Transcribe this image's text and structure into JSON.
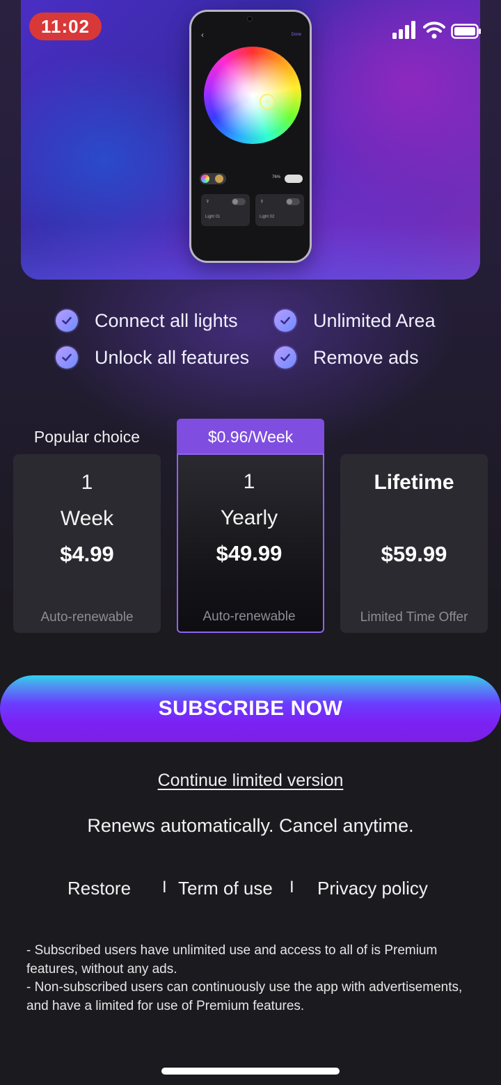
{
  "status_bar": {
    "time": "11:02"
  },
  "hero": {
    "phone": {
      "done_label": "Done",
      "brightness": "76%",
      "lights": [
        "Light 01",
        "Light 02"
      ]
    }
  },
  "features": [
    {
      "label": "Connect all lights"
    },
    {
      "label": "Unlimited Area"
    },
    {
      "label": "Unlock all features"
    },
    {
      "label": "Remove ads"
    }
  ],
  "plans": {
    "popular_label": "Popular choice",
    "selected_badge": "$0.96/Week",
    "items": [
      {
        "qty": "1",
        "period": "Week",
        "price": "$4.99",
        "footnote": "Auto-renewable"
      },
      {
        "qty": "1",
        "period": "Yearly",
        "price": "$49.99",
        "footnote": "Auto-renewable",
        "selected": true
      },
      {
        "title": "Lifetime",
        "price": "$59.99",
        "footnote": "Limited Time Offer"
      }
    ]
  },
  "cta": {
    "subscribe_label": "SUBSCRIBE NOW"
  },
  "continue_label": "Continue limited version",
  "renews_text": "Renews automatically. Cancel anytime.",
  "footer_links": {
    "restore": "Restore",
    "separator": "I",
    "terms": "Term of use",
    "privacy": "Privacy policy"
  },
  "notes": [
    "- Subscribed users have unlimited use and access to all of is Premium features, without any ads.",
    "- Non-subscribed users can continuously use the app with advertisements, and have a limited for use of Premium features."
  ],
  "colors": {
    "accent_purple": "#7f4ee0",
    "selected_border": "#8f63f0",
    "time_pill": "#d93838",
    "cta_top": "#2fd2ee",
    "cta_bottom": "#7b22f4"
  }
}
